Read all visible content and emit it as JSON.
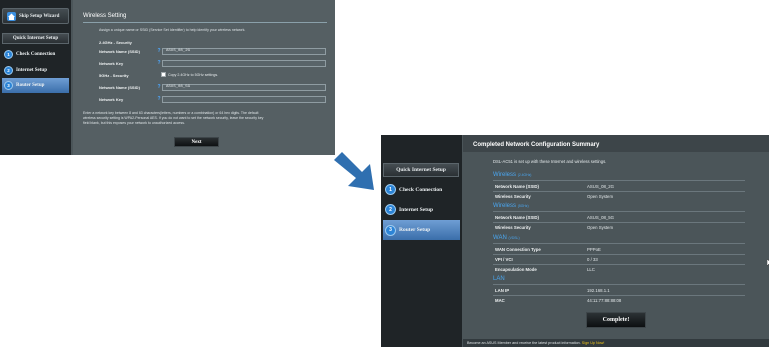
{
  "screen1": {
    "sidebar": {
      "skip_label": "Skip Setup Wizard",
      "header_label": "Quick Internet Setup",
      "items": [
        {
          "num": "1",
          "label": "Check Connection"
        },
        {
          "num": "2",
          "label": "Internet Setup"
        },
        {
          "num": "3",
          "label": "Router Setup"
        }
      ]
    },
    "title": "Wireless Setting",
    "description": "Assign a unique name or SSID (Service Set Identifier) to help identify your wireless network.",
    "band_24_header": "2.4GHz - Security",
    "band_5_header": "5GHz - Security",
    "ssid_label": "Network Name (SSID)",
    "key_label": "Network Key",
    "help_icon": "?",
    "ssid_24_value": "ASUS_08_2G",
    "key_24_value": "",
    "copy_label": "Copy 2.4GHz to 5GHz settings.",
    "ssid_5_value": "ASUS_08_5G",
    "key_5_value": "",
    "note_line1": "Enter a network key between 8 and 63 characters(letters, numbers or a combination) or 64 hex digits. The default",
    "note_line2": "wireless security setting is WPA2-Personal AES. If you do not want to set the network security, leave the security key",
    "note_line3": "field blank, but this exposes your network to unauthorized access.",
    "next_label": "Next"
  },
  "screen2": {
    "sidebar": {
      "header_label": "Quick Internet Setup",
      "items": [
        {
          "num": "1",
          "label": "Check Connection"
        },
        {
          "num": "2",
          "label": "Internet Setup"
        },
        {
          "num": "3",
          "label": "Router Setup"
        }
      ]
    },
    "title": "Completed Network Configuration Summary",
    "intro": "DSL-AC51 is set up with these Internet and wireless settings.",
    "sections": {
      "w24_title": "Wireless",
      "w24_band": "(2.4GHz)",
      "w5_title": "Wireless",
      "w5_band": "(5GHz)",
      "wan_title": "WAN",
      "wan_band": "(VDSL)",
      "lan_title": "LAN"
    },
    "rows": {
      "w24_ssid_key": "Network Name (SSID)",
      "w24_ssid_val": "ASUS_08_2G",
      "w24_sec_key": "Wireless Security",
      "w24_sec_val": "Open System",
      "w5_ssid_key": "Network Name (SSID)",
      "w5_ssid_val": "ASUS_08_5G",
      "w5_sec_key": "Wireless Security",
      "w5_sec_val": "Open System",
      "wan_type_key": "WAN Connection Type",
      "wan_type_val": "PPPoE",
      "vpi_key": "VPI / VCI",
      "vpi_val": "0 / 33",
      "enc_key": "Encapsulation Mode",
      "enc_val": "LLC",
      "lan_ip_key": "LAN IP",
      "lan_ip_val": "192.168.1.1",
      "mac_key": "MAC",
      "mac_val": "44:11:77:88:88:08"
    },
    "complete_label": "Complete!",
    "footer_text": "Become an ASUS Member and receive the latest product information.",
    "footer_link": "Sign Up Now!"
  },
  "colors": {
    "accent_blue": "#4aa6f0",
    "panel": "#4b5559",
    "sidebar": "#1f2427",
    "footer_link": "#f0c419"
  }
}
